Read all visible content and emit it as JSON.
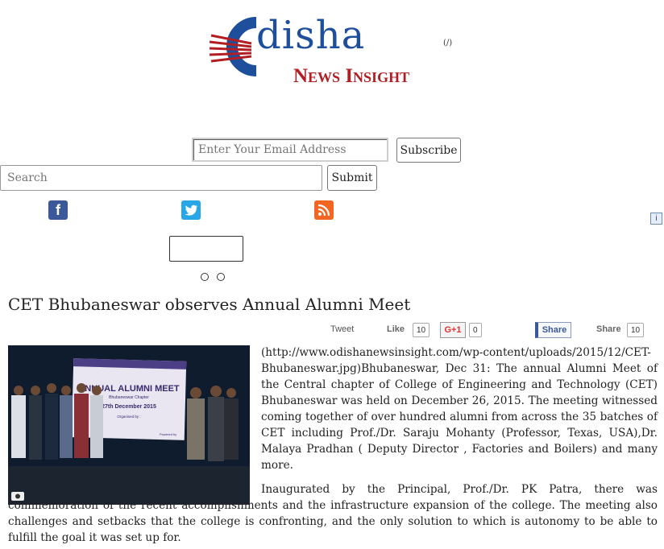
{
  "logo": {
    "main_text": "disha",
    "sub_text": "News Insight",
    "mark": "(/)"
  },
  "subscribe": {
    "email_placeholder": "Enter Your Email Address",
    "button_label": "Subscribe"
  },
  "search": {
    "placeholder": "Search",
    "button_label": "Submit"
  },
  "social": {
    "facebook_icon": "facebook-icon",
    "twitter_icon": "twitter-icon",
    "rss_icon": "rss-icon"
  },
  "info_icon": "i",
  "slider_dots": 2,
  "article": {
    "title": "CET Bhubaneswar observes Annual Alumni Meet",
    "share": {
      "tweet_label": "Tweet",
      "like_label": "Like",
      "like_count": "10",
      "gplus_label": "G+1",
      "gplus_count": "0",
      "fb_share_label": "Share",
      "share_label": "Share",
      "share_count": "10"
    },
    "photo": {
      "banner_title": "ANNUAL ALUMNI MEET",
      "banner_chapter": "Bhubaneswar Chapter",
      "banner_date": "27th December 2015",
      "banner_org": "Organised by :",
      "banner_powered": "Powered by"
    },
    "paragraph1": "(http://www.odishanewsinsight.com/wp-content/uploads/2015/12/CET-Bhubaneswar.jpg)Bhubaneswar, Dec 31: The annual Alumni Meet of the Central chapter of College of Engineering and Technology (CET) Bhubaneswar was held on December 26, 2015. The meeting witnessed coming together of over hundred alumni from across the 35 batches of CET including Prof./Dr. Saraju Mohanty (Professor, Texas, USA),Dr. Malaya Pradhan ( Deputy Director , Factories and Boilers) and many more.",
    "paragraph2": "Inaugurated by the Principal, Prof./Dr. PK Patra, there was commemoration of the recent accomplishments and the infrastructure expansion of the college. The meeting also challenges and setbacks that the college is confronting, and the only solution to which is autonomy to be able to fulfill the goal it was set up for."
  }
}
